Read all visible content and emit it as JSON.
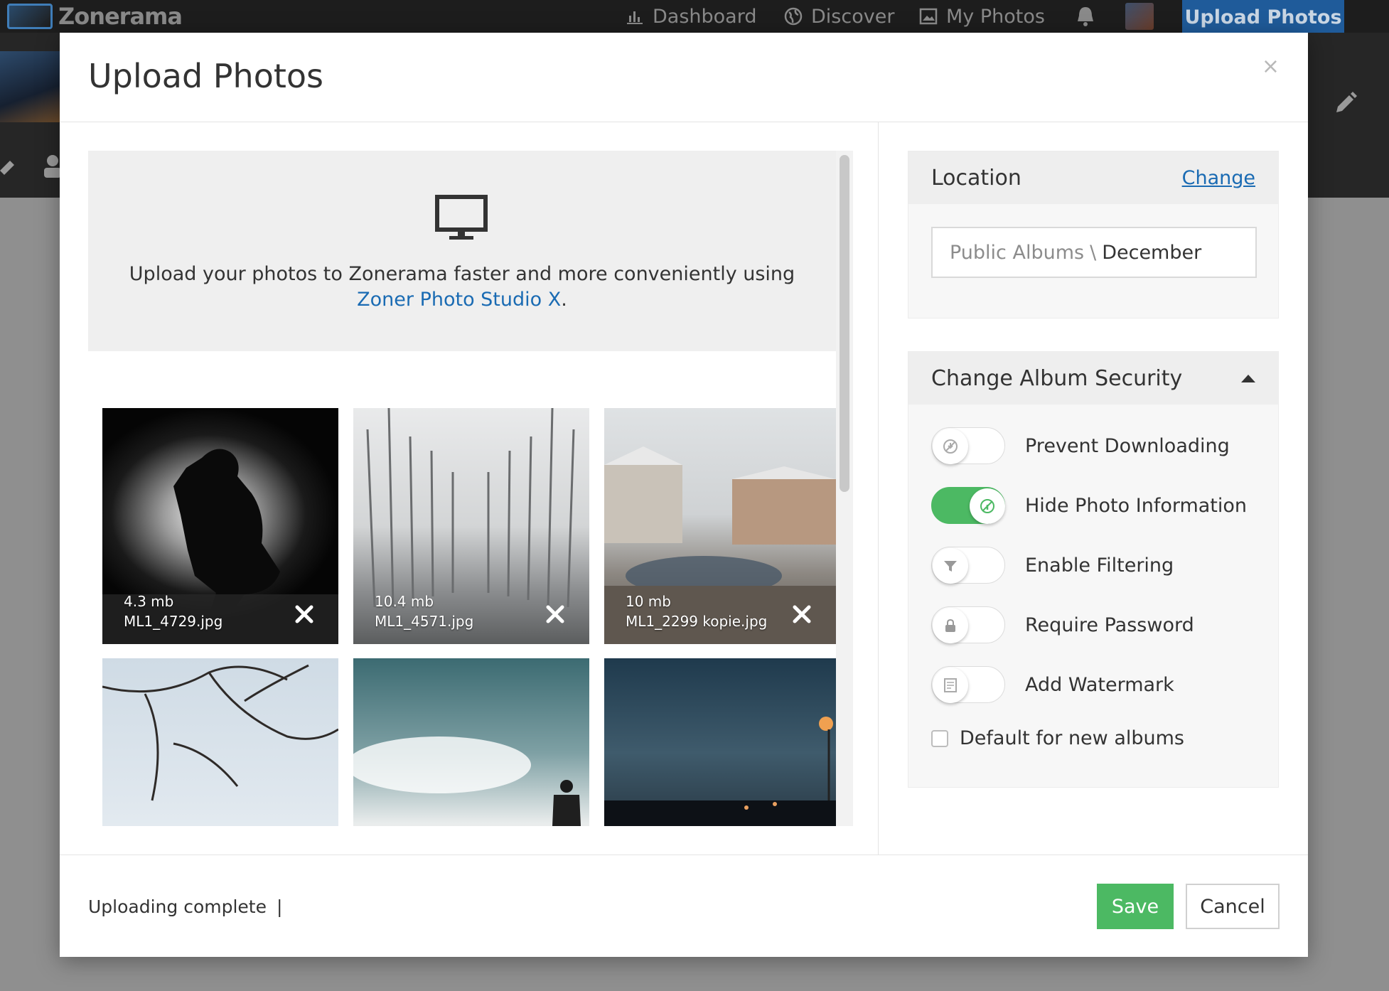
{
  "app": {
    "logo_text": "Zonerama",
    "nav": {
      "dashboard": "Dashboard",
      "discover": "Discover",
      "my_photos": "My Photos",
      "upload": "Upload Photos"
    }
  },
  "modal": {
    "title": "Upload Photos",
    "close_glyph": "×",
    "promo": {
      "text": "Upload your photos to Zonerama faster and more conveniently using",
      "link_text": "Zoner Photo Studio X",
      "suffix": "."
    },
    "photos": [
      {
        "size": "4.3 mb",
        "name": "ML1_4729.jpg"
      },
      {
        "size": "10.4 mb",
        "name": "ML1_4571.jpg"
      },
      {
        "size": "10 mb",
        "name": "ML1_2299 kopie.jpg"
      }
    ],
    "location": {
      "title": "Location",
      "change_label": "Change",
      "path": "Public Albums",
      "separator": "\\",
      "current": "December"
    },
    "security": {
      "title": "Change Album Security",
      "options": [
        {
          "label": "Prevent Downloading",
          "on": false,
          "icon": "no-download-icon"
        },
        {
          "label": "Hide Photo Information",
          "on": true,
          "icon": "hide-info-icon"
        },
        {
          "label": "Enable Filtering",
          "on": false,
          "icon": "filter-icon"
        },
        {
          "label": "Require Password",
          "on": false,
          "icon": "lock-icon"
        },
        {
          "label": "Add Watermark",
          "on": false,
          "icon": "watermark-icon"
        }
      ],
      "default_label": "Default for new albums"
    },
    "footer": {
      "status": "Uploading complete",
      "status_caret": "|",
      "save_label": "Save",
      "cancel_label": "Cancel"
    }
  },
  "colors": {
    "accent_blue": "#1a6bb3",
    "save_green": "#4cb963",
    "nav_upload_bg": "#1f5b9a"
  }
}
